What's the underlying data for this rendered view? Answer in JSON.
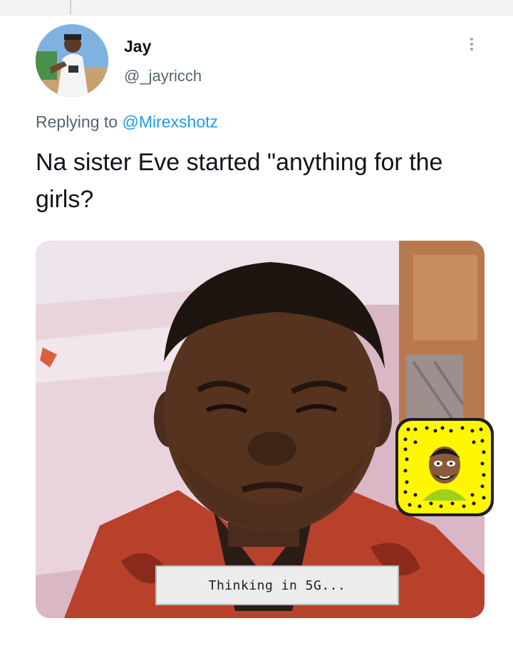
{
  "tweet": {
    "author_name": "Jay",
    "author_handle": "@_jayricch",
    "reply_prefix": "Replying to",
    "reply_to": "@Mirexshotz",
    "text": "Na sister Eve started \"anything for the girls?"
  },
  "media": {
    "caption": "Thinking in 5G...",
    "icons": [
      "more-options-icon",
      "snapcode-icon",
      "bitmoji-icon"
    ]
  },
  "colors": {
    "text": "#0f1419",
    "secondary": "#536471",
    "link": "#1d9bf0",
    "snapcode_yellow": "#fff601"
  }
}
